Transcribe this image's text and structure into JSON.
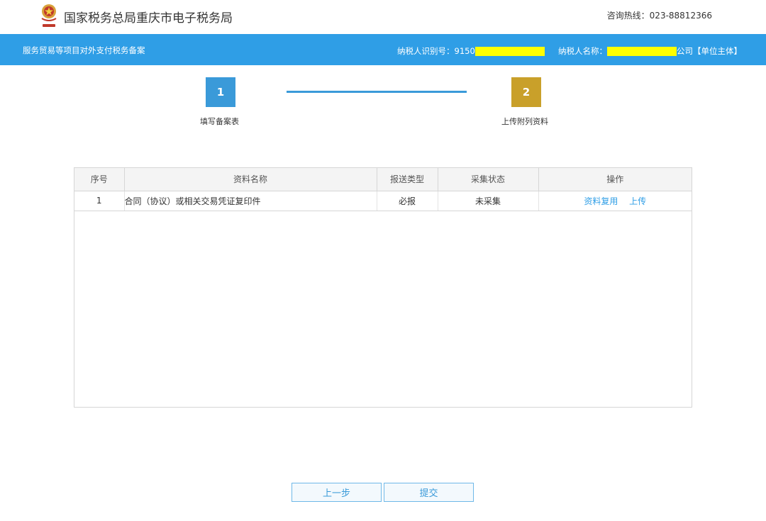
{
  "header": {
    "site_title": "国家税务总局重庆市电子税务局",
    "hotline": "咨询热线：023-88812366"
  },
  "bar": {
    "breadcrumb": "服务贸易等项目对外支付税务备案",
    "taxpayer_id_label": "纳税人识别号：9150",
    "taxpayer_name_label": "纳税人名称：",
    "taxpayer_name_suffix": "公司【单位主体】"
  },
  "steps": [
    {
      "number": "1",
      "label": "填写备案表"
    },
    {
      "number": "2",
      "label": "上传附列资料"
    }
  ],
  "table": {
    "headers": [
      "序号",
      "资料名称",
      "报送类型",
      "采集状态",
      "操作"
    ],
    "rows": [
      {
        "index": "1",
        "name": "合同（协议）或相关交易凭证复印件",
        "type": "必报",
        "status": "未采集",
        "action_reuse": "资料复用",
        "action_upload": "上传"
      }
    ]
  },
  "buttons": {
    "prev": "上一步",
    "submit": "提交"
  },
  "colors": {
    "bar": "#2f9ee6",
    "step_active": "#3a9ad9",
    "step_current": "#c9a02a",
    "redaction": "#ffff00"
  }
}
